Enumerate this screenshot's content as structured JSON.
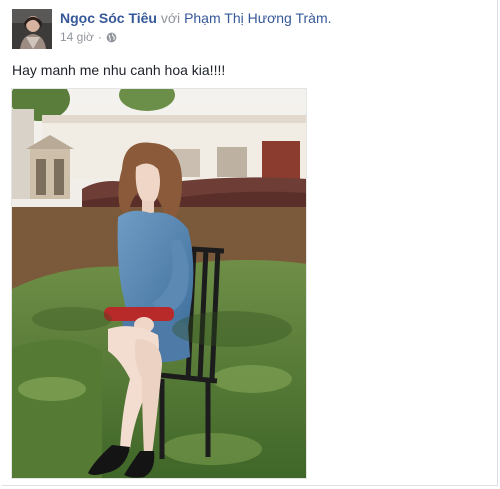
{
  "post": {
    "author": "Ngọc Sóc Tiêu",
    "with_text": "với",
    "tagged": "Phạm Thị Hương Tràm.",
    "time": "14 giờ",
    "separator": "·",
    "privacy_icon": "globe-icon",
    "text": "Hay manh me nhu canh hoa kia!!!!"
  },
  "colors": {
    "link": "#365899",
    "meta": "#90949c",
    "text": "#1d2129"
  }
}
